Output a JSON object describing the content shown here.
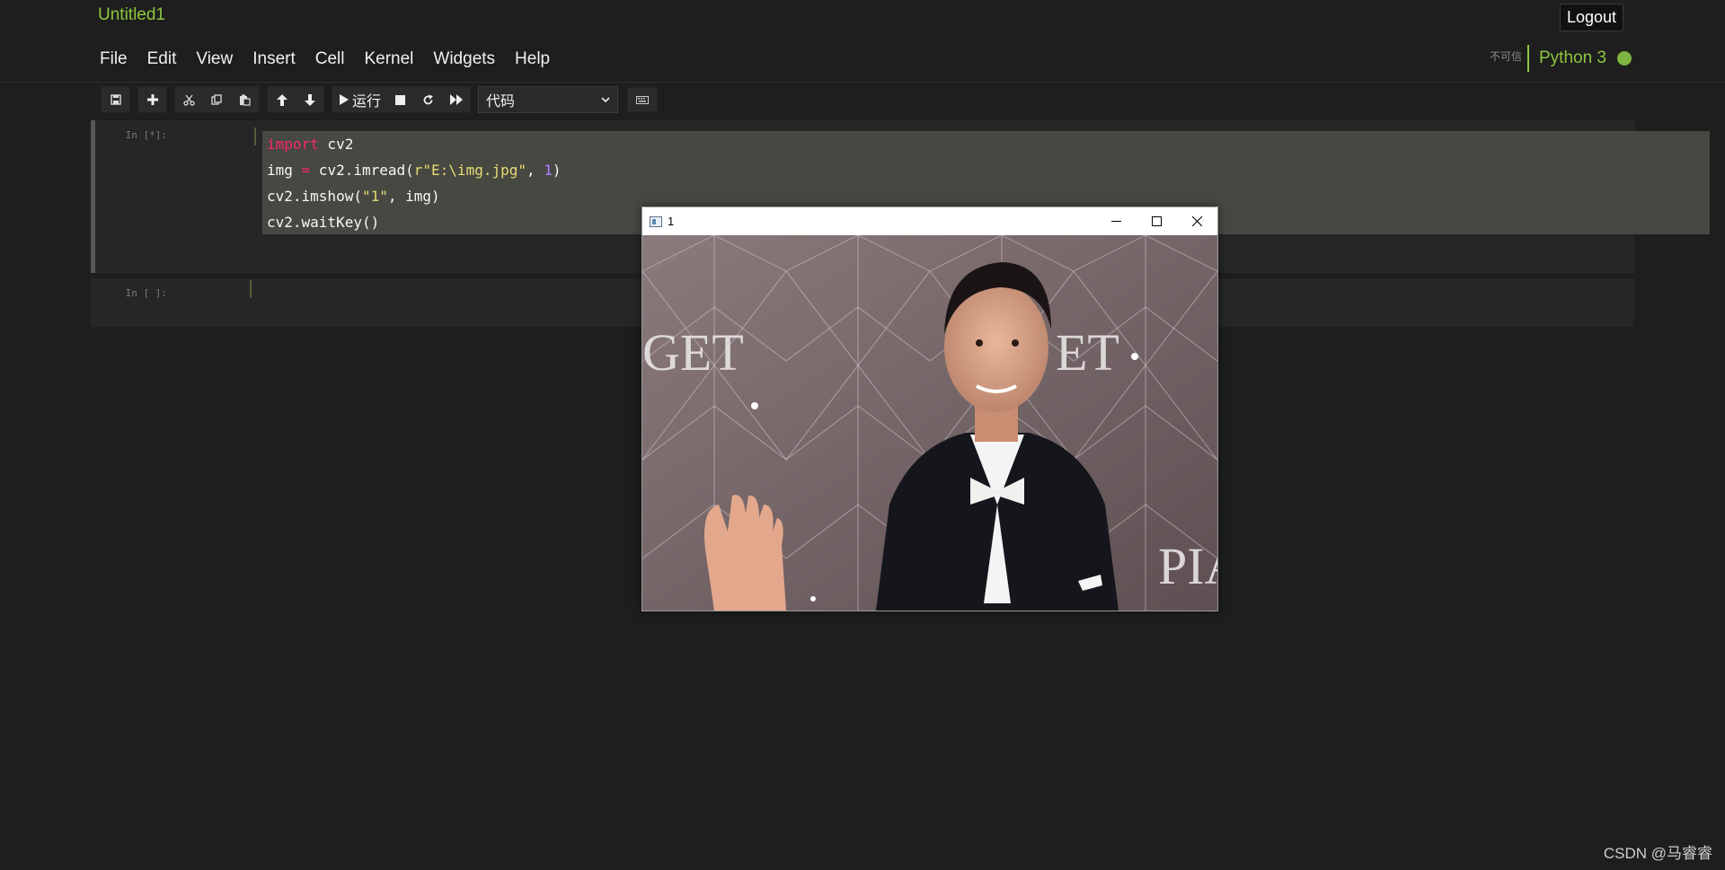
{
  "header": {
    "notebook_title": "Untitled1",
    "logout_label": "Logout",
    "trust_status": "不可信",
    "kernel_name": "Python 3",
    "kernel_status_color": "#7cb341"
  },
  "menu": {
    "items": [
      "File",
      "Edit",
      "View",
      "Insert",
      "Cell",
      "Kernel",
      "Widgets",
      "Help"
    ]
  },
  "toolbar": {
    "icons": [
      "save-icon",
      "plus-icon",
      "cut-icon",
      "copy-icon",
      "paste-icon",
      "arrow-up-icon",
      "arrow-down-icon",
      "play-icon",
      "stop-icon",
      "restart-icon",
      "fast-forward-icon",
      "keyboard-icon"
    ],
    "run_label": "运行",
    "cell_type": "代码"
  },
  "cells": [
    {
      "prompt": "In [*]:",
      "lines": [
        "import cv2",
        "img = cv2.imread(r\"E:\\img.jpg\", 1)",
        "cv2.imshow(\"1\", img)",
        "cv2.waitKey()"
      ]
    },
    {
      "prompt": "In [ ]:",
      "lines": []
    }
  ],
  "image_window": {
    "title": "1",
    "image_description_icon": "photo-window-icon"
  },
  "watermark": "CSDN @马睿睿",
  "colors": {
    "accent_green": "#8cc63f",
    "background": "#1e1e1e",
    "cell_background": "#262626",
    "code_highlight": "#484842"
  }
}
